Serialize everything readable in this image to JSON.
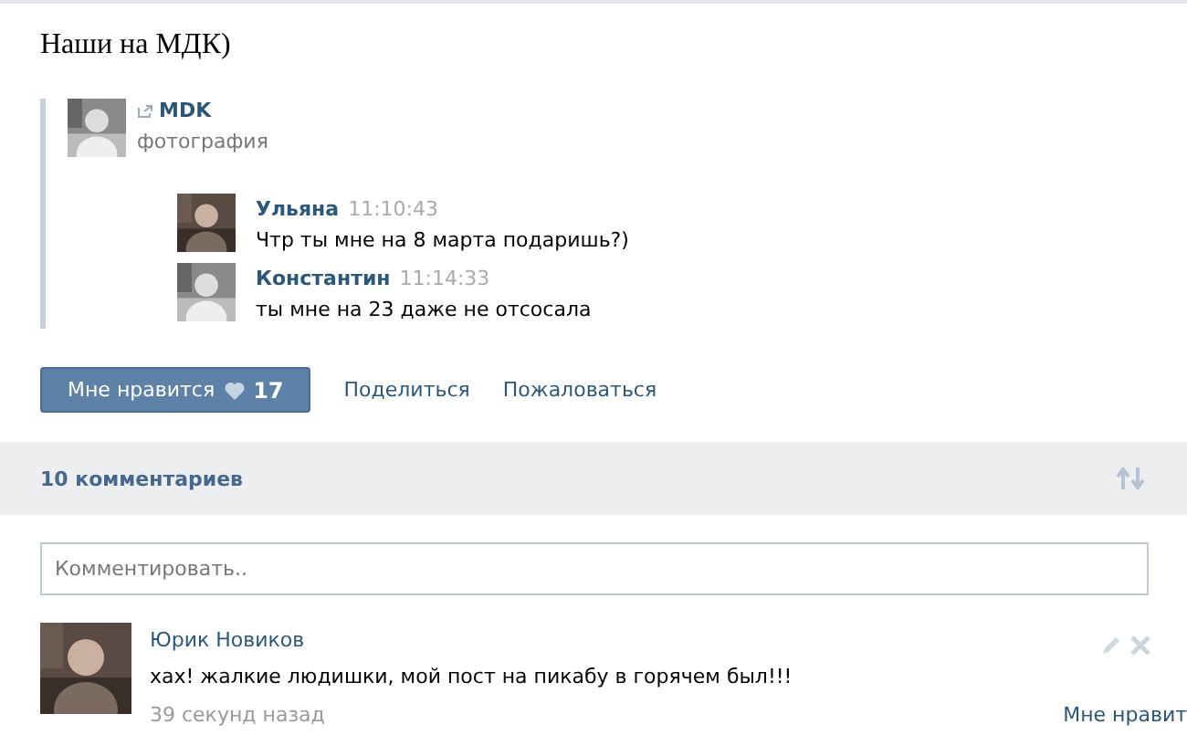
{
  "post": {
    "title": "Наши на МДК)",
    "repost": {
      "source": "MDK",
      "subtitle": "фотография",
      "messages": [
        {
          "author": "Ульяна",
          "time": "11:10:43",
          "text": "Чтр ты мне на 8 марта подаришь?)"
        },
        {
          "author": "Константин",
          "time": "11:14:33",
          "text": "ты мне на 23 даже не отсосала"
        }
      ]
    },
    "actions": {
      "like_label": "Мне нравится",
      "like_count": "17",
      "share": "Поделиться",
      "report": "Пожаловаться"
    }
  },
  "comments_header": {
    "count_label": "10 комментариев"
  },
  "comment_field": {
    "placeholder": "Комментировать.."
  },
  "comments": [
    {
      "author": "Юрик Новиков",
      "text": "хах! жалкие людишки, мой пост на пикабу в горячем был!!!",
      "time": "39 секунд назад",
      "like": "Мне нравит"
    }
  ]
}
